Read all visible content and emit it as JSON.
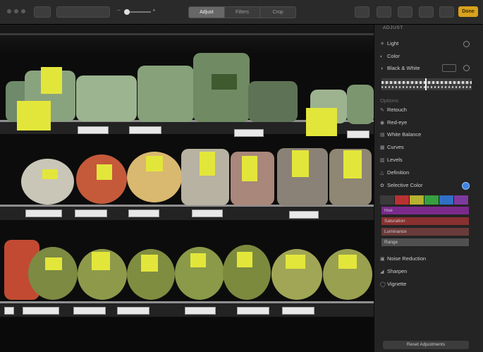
{
  "toolbar": {
    "buttons": [
      "",
      "",
      "",
      "",
      "",
      ""
    ],
    "segments": [
      "Adjust",
      "Filters",
      "Crop"
    ],
    "done": "Done"
  },
  "panel": {
    "title": "ADJUST",
    "items": [
      {
        "label": "Light",
        "icon": "sun-icon"
      },
      {
        "label": "Color",
        "icon": "color-icon"
      },
      {
        "label": "Black & White",
        "icon": "bw-icon"
      }
    ],
    "options_header": "Options",
    "tools": [
      {
        "label": "Retouch",
        "icon": "bandage-icon"
      },
      {
        "label": "Red-eye",
        "icon": "eye-icon"
      },
      {
        "label": "White Balance",
        "icon": "wb-icon"
      },
      {
        "label": "Curves",
        "icon": "curves-icon"
      },
      {
        "label": "Levels",
        "icon": "levels-icon"
      },
      {
        "label": "Definition",
        "icon": "triangle-icon"
      },
      {
        "label": "Selective Color",
        "icon": "palette-icon"
      }
    ],
    "selective_bars": [
      "Hue",
      "Saturation",
      "Luminance",
      "Range"
    ],
    "bottom_tools": [
      {
        "label": "Noise Reduction",
        "icon": "grid-icon"
      },
      {
        "label": "Sharpen",
        "icon": "sharpen-icon"
      },
      {
        "label": "Vignette",
        "icon": "vignette-icon"
      }
    ],
    "reset": "Reset Adjustments"
  },
  "colors": {
    "accent": "#d9a21c",
    "hue_bar": "#7b2a8c",
    "saturation_bar": "#8a3030",
    "luminance_bar": "#6b3a3a",
    "range_bar": "#505050",
    "label_yellow": "#e3e63a"
  }
}
